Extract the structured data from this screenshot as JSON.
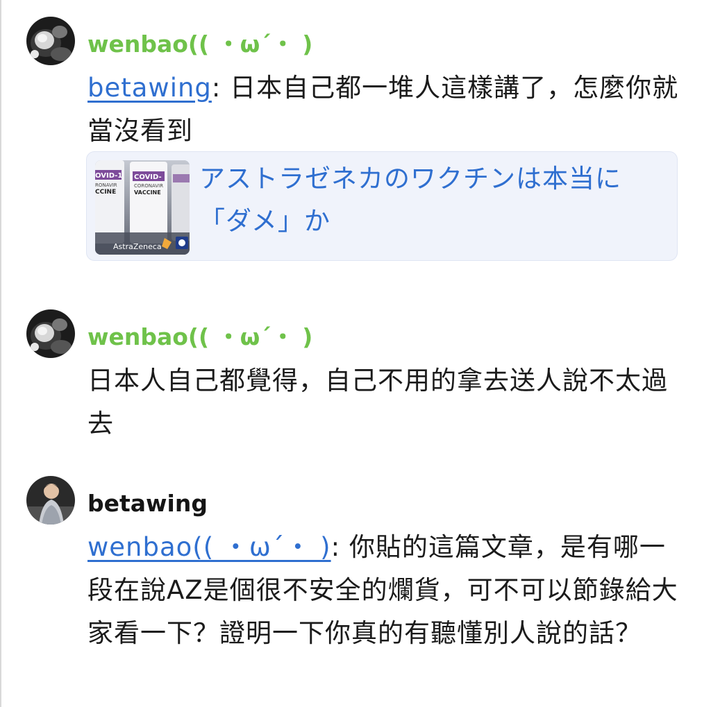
{
  "comments": [
    {
      "username": "wenbao(( ・ω´・ )",
      "mention": "betawing",
      "text": ": 日本自己都一堆人這樣講了，怎麼你就當沒看到",
      "link_card": {
        "title": "アストラゼネカのワクチンは本当に「ダメ」か",
        "thumbnail_labels": [
          "OVID-1",
          "RONAVIR",
          "CCINE",
          "COVID-",
          "CORONAVIR",
          "VACCINE",
          "AstraZeneca"
        ]
      }
    },
    {
      "username": "wenbao(( ・ω´・ )",
      "text": "日本人自己都覺得，自己不用的拿去送人說不太過去"
    },
    {
      "username": "betawing",
      "mention": "wenbao(( ・ω´・ )",
      "text": ": 你貼的這篇文章，是有哪一段在說AZ是個很不安全的爛貨，可不可以節錄給大家看一下？證明一下你真的有聽懂別人說的話？"
    }
  ],
  "colors": {
    "username_green": "#6fc24a",
    "mention_blue": "#2f6fd0",
    "card_background": "#f0f3fb"
  },
  "icons": {
    "avatar1": "avatar-icon",
    "avatar2": "avatar-icon",
    "avatar3": "avatar-icon"
  }
}
